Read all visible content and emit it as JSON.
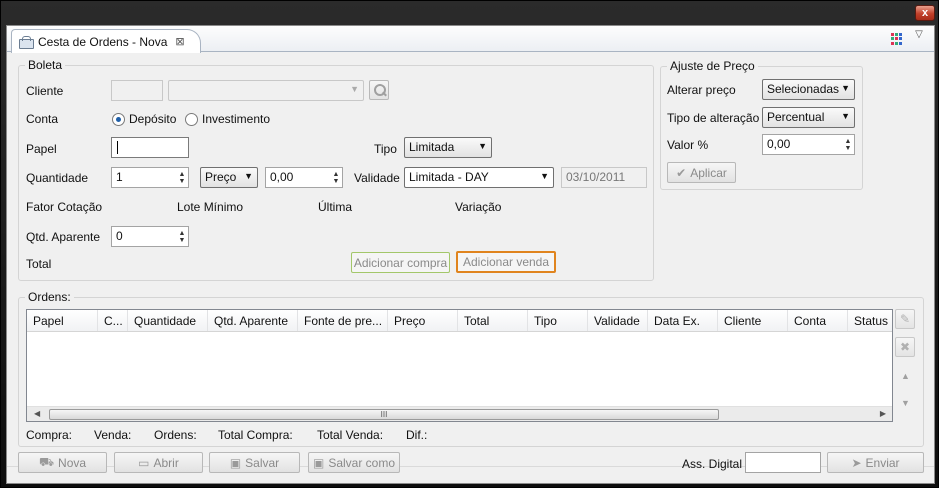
{
  "window": {
    "close_label": "x"
  },
  "tab": {
    "title": "Cesta de Ordens - Nova",
    "close": "⊠"
  },
  "boleta": {
    "title": "Boleta",
    "cliente_label": "Cliente",
    "conta_label": "Conta",
    "conta_options": [
      "Depósito",
      "Investimento"
    ],
    "conta_selected": "Depósito",
    "papel_label": "Papel",
    "papel_value": "",
    "tipo_label": "Tipo",
    "tipo_value": "Limitada",
    "quantidade_label": "Quantidade",
    "quantidade_value": "1",
    "preco_mode": "Preço",
    "preco_value": "0,00",
    "validade_label": "Validade",
    "validade_value": "Limitada - DAY",
    "validade_date": "03/10/2011",
    "fator_cotacao_label": "Fator Cotação",
    "lote_minimo_label": "Lote Mínimo",
    "ultima_label": "Última",
    "variacao_label": "Variação",
    "qtd_aparente_label": "Qtd. Aparente",
    "qtd_aparente_value": "0",
    "total_label": "Total",
    "add_buy_label": "Adicionar compra",
    "add_sell_label": "Adicionar venda"
  },
  "ajuste": {
    "title": "Ajuste de Preço",
    "alterar_label": "Alterar preço",
    "alterar_value": "Selecionadas",
    "tipo_alteracao_label": "Tipo de alteração",
    "tipo_alteracao_value": "Percentual",
    "valor_label": "Valor %",
    "valor_value": "0,00",
    "aplicar_label": "Aplicar"
  },
  "ordens": {
    "title": "Ordens:",
    "columns": [
      "Papel",
      "C...",
      "Quantidade",
      "Qtd. Aparente",
      "Fonte de pre...",
      "Preço",
      "Total",
      "Tipo",
      "Validade",
      "Data Ex.",
      "Cliente",
      "Conta",
      "Status"
    ],
    "scroll_grip": "III"
  },
  "summary": {
    "compra": "Compra:",
    "venda": "Venda:",
    "ordens": "Ordens:",
    "total_compra": "Total Compra:",
    "total_venda": "Total Venda:",
    "dif": "Dif.:"
  },
  "footer": {
    "nova": "Nova",
    "abrir": "Abrir",
    "salvar": "Salvar",
    "salvar_como": "Salvar como",
    "ass_digital": "Ass. Digital",
    "enviar": "Enviar"
  },
  "colors": {
    "buy_border": "#a3c76a",
    "sell_border": "#e0841e",
    "tab_border": "#a9b4c2"
  }
}
